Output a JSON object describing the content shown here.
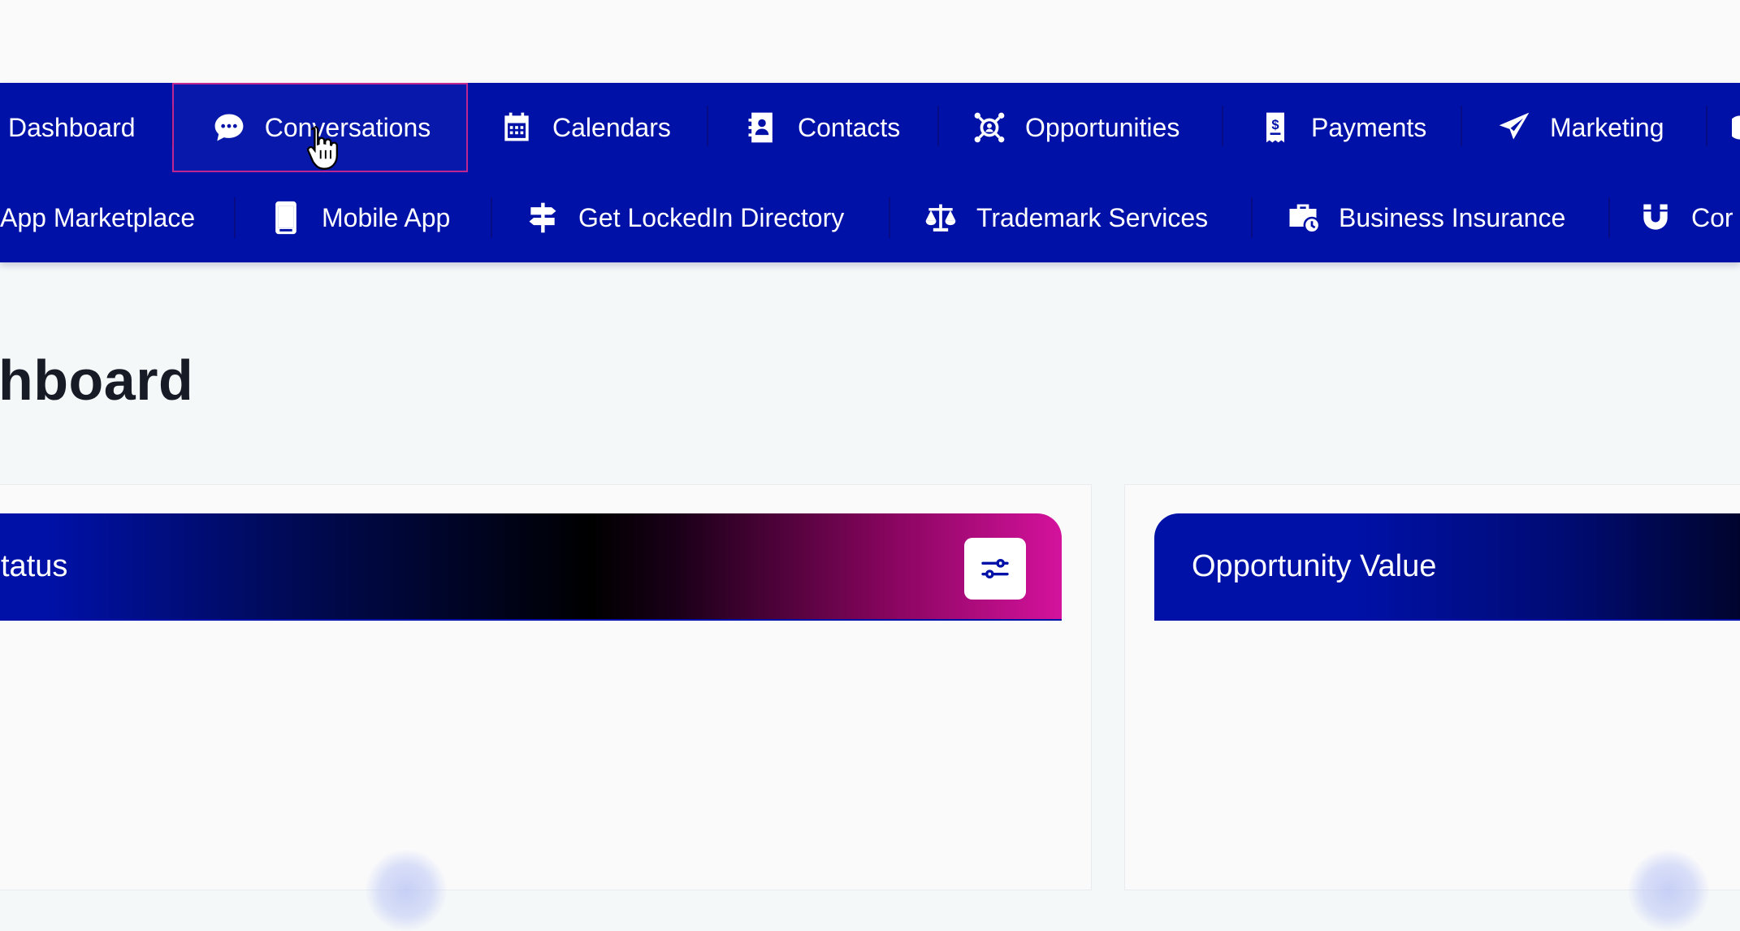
{
  "nav": {
    "row1": [
      {
        "label": "Dashboard",
        "icon": "none"
      },
      {
        "label": "Conversations",
        "icon": "chat-bubble-icon"
      },
      {
        "label": "Calendars",
        "icon": "calendar-icon"
      },
      {
        "label": "Contacts",
        "icon": "address-book-icon"
      },
      {
        "label": "Opportunities",
        "icon": "target-network-icon"
      },
      {
        "label": "Payments",
        "icon": "receipt-dollar-icon"
      },
      {
        "label": "Marketing",
        "icon": "paper-plane-icon"
      }
    ],
    "row2": [
      {
        "label": "App Marketplace",
        "icon": "none"
      },
      {
        "label": "Mobile App",
        "icon": "mobile-phone-icon"
      },
      {
        "label": "Get LockedIn Directory",
        "icon": "signpost-icon"
      },
      {
        "label": "Trademark Services",
        "icon": "scales-icon"
      },
      {
        "label": "Business Insurance",
        "icon": "briefcase-clock-icon"
      },
      {
        "label": "Cor",
        "icon": "magnet-icon"
      }
    ],
    "hovered_item": "Conversations"
  },
  "page": {
    "title": "hboard"
  },
  "cards": {
    "left": {
      "title": "tatus"
    },
    "right": {
      "title": "Opportunity Value"
    }
  },
  "colors": {
    "nav_background": "#0011a8",
    "hover_border": "#c0268f",
    "gradient_pink": "#d4129c",
    "page_background": "#f5f8f9"
  }
}
